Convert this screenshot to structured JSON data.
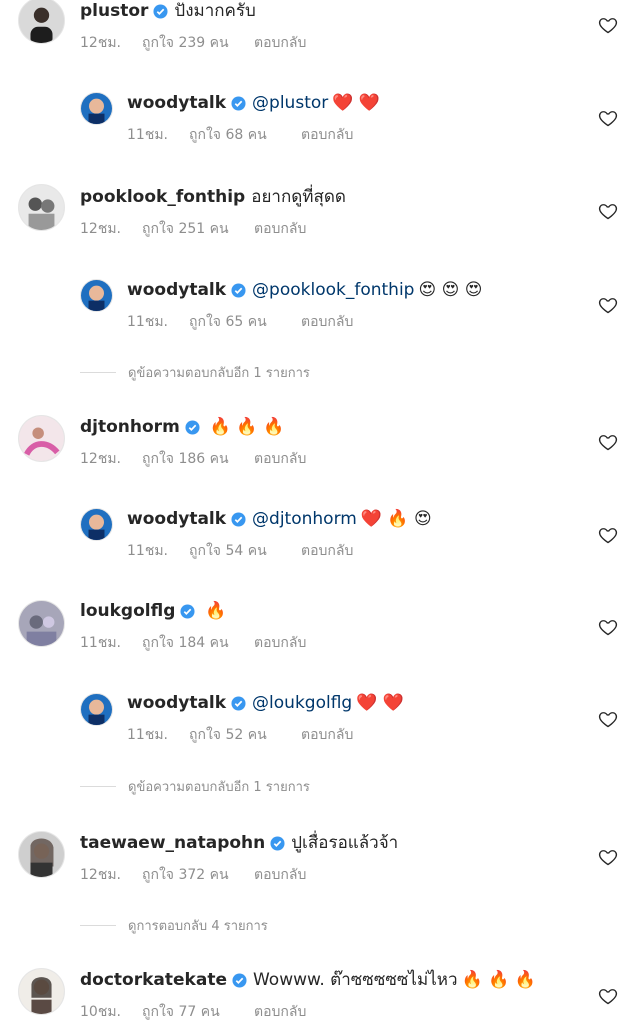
{
  "labels": {
    "likes_prefix": "ถูกใจ",
    "reply": "ตอบกลับ"
  },
  "comments": [
    {
      "kind": "top",
      "user": "plustor",
      "verified": true,
      "text": "ปังมากครับ",
      "emoji": "",
      "time": "12ชม.",
      "likes": "ถูกใจ 239 คน",
      "reply": "ตอบกลับ"
    },
    {
      "kind": "reply",
      "user": "woodytalk",
      "verified": true,
      "mention": "@plustor",
      "emoji": "❤️ ❤️",
      "time": "11ชม.",
      "likes": "ถูกใจ 68 คน",
      "reply": "ตอบกลับ"
    },
    {
      "kind": "top",
      "user": "pooklook_fonthip",
      "verified": false,
      "text": "อยากดูที่สุดด",
      "emoji": "",
      "time": "12ชม.",
      "likes": "ถูกใจ 251 คน",
      "reply": "ตอบกลับ"
    },
    {
      "kind": "reply",
      "user": "woodytalk",
      "verified": true,
      "mention": "@pooklook_fonthip",
      "emoji": "😍 😍 😍",
      "time": "11ชม.",
      "likes": "ถูกใจ 65 คน",
      "reply": "ตอบกลับ"
    },
    {
      "kind": "top",
      "user": "djtonhorm",
      "verified": true,
      "text": "",
      "emoji": "🔥 🔥 🔥",
      "time": "12ชม.",
      "likes": "ถูกใจ 186 คน",
      "reply": "ตอบกลับ"
    },
    {
      "kind": "reply",
      "user": "woodytalk",
      "verified": true,
      "mention": "@djtonhorm",
      "emoji": "❤️ 🔥 😍",
      "time": "11ชม.",
      "likes": "ถูกใจ 54 คน",
      "reply": "ตอบกลับ"
    },
    {
      "kind": "top",
      "user": "loukgolflg",
      "verified": true,
      "text": "",
      "emoji": "🔥",
      "time": "11ชม.",
      "likes": "ถูกใจ 184 คน",
      "reply": "ตอบกลับ"
    },
    {
      "kind": "reply",
      "user": "woodytalk",
      "verified": true,
      "mention": "@loukgolflg",
      "emoji": "❤️ ❤️",
      "time": "11ชม.",
      "likes": "ถูกใจ 52 คน",
      "reply": "ตอบกลับ"
    },
    {
      "kind": "top",
      "user": "taewaew_natapohn",
      "verified": true,
      "text": "ปูเสื่อรอแล้วจ้า",
      "emoji": "",
      "time": "12ชม.",
      "likes": "ถูกใจ 372 คน",
      "reply": "ตอบกลับ"
    },
    {
      "kind": "top",
      "user": "doctorkatekate",
      "verified": true,
      "text": "Wowww. ต๊าซซซซซไม่ไหว",
      "emoji": "🔥 🔥 🔥",
      "time": "10ชม.",
      "likes": "ถูกใจ 77 คน",
      "reply": "ตอบกลับ"
    }
  ],
  "view_more": [
    "ดูข้อความตอบกลับอีก 1 รายการ",
    "ดูข้อความตอบกลับอีก 1 รายการ",
    "ดูการตอบกลับ 4 รายการ"
  ],
  "colors": {
    "verified": "#3897f0",
    "mention": "#00376b",
    "meta": "#8e8e8e"
  }
}
